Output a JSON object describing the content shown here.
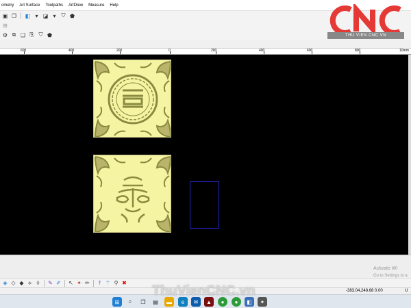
{
  "menu": {
    "items": [
      "ometry",
      "Art Surface",
      "Toolpaths",
      "ArtDlew",
      "Measure",
      "Help"
    ]
  },
  "ruler": {
    "labels": [
      "600",
      "400",
      "200",
      "0",
      "200",
      "400",
      "600",
      "800",
      "10mm"
    ]
  },
  "logo": {
    "text": "CNC",
    "subtitle": "THU VIEN CNC.VN",
    "colors": {
      "red": "#e53935",
      "grey": "#9a9a9a"
    }
  },
  "activate": {
    "line1": "Activate Wi",
    "line2": "Go to Settings to a"
  },
  "status": {
    "coords": "-383.04,248.68 0.00",
    "unit": "U"
  },
  "watermark": "ThuVienCNC.vn",
  "colors": {
    "viewport": "#000000",
    "relief": "#f4f4a2",
    "relief_dark": "#8a8a40",
    "selection": "#2626c8"
  },
  "taskbar": {
    "icons": [
      "windows-icon",
      "search-icon",
      "task-view-icon",
      "widgets-icon",
      "file-explorer-icon",
      "edge-icon",
      "mail-icon",
      "app-icon",
      "chrome-icon",
      "chrome-icon-2",
      "app-2-icon",
      "app-3-icon"
    ]
  }
}
